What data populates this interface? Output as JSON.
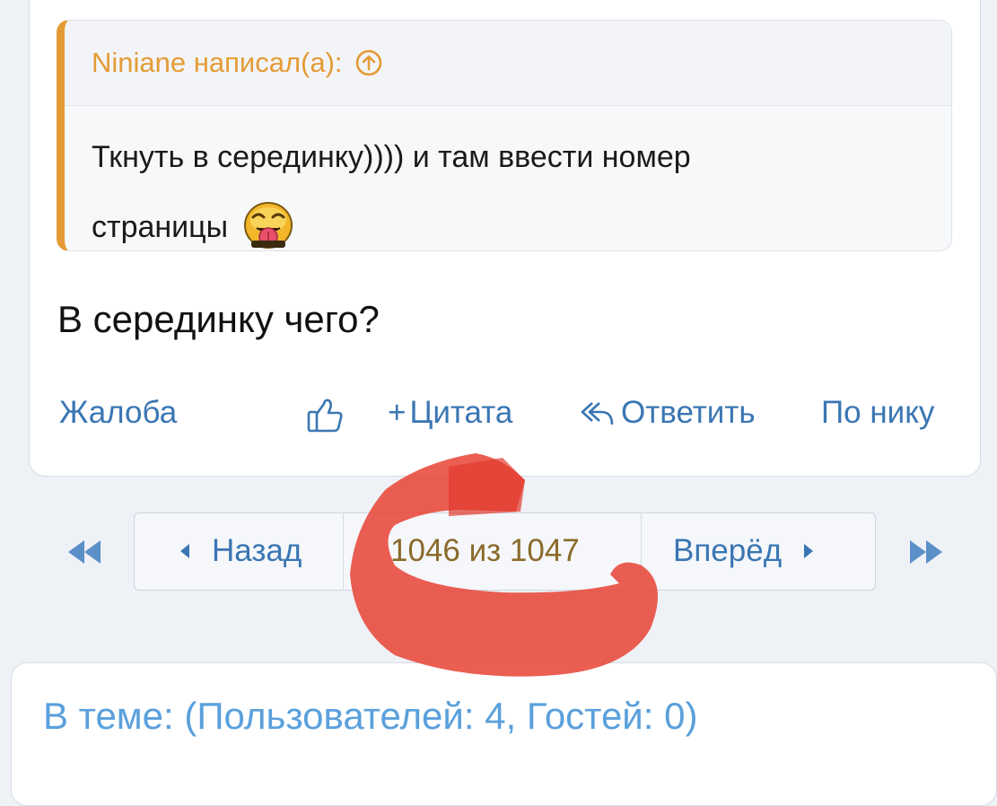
{
  "quote": {
    "author_line": "Niniane написал(а):",
    "text_line1": "Ткнуть в серединку)))) и там ввести номер",
    "text_line2": "страницы"
  },
  "post": {
    "text": "В серединку чего?"
  },
  "actions": {
    "report": "Жалоба",
    "quote": "Цитата",
    "reply": "Ответить",
    "by_nick": "По нику"
  },
  "pager": {
    "prev": "Назад",
    "info": "1046 из 1047",
    "next": "Вперёд"
  },
  "users": {
    "title": "В теме: (Пользователей: 4, Гостей: 0)"
  },
  "colors": {
    "accent": "#3a76b3",
    "quote_accent": "#e49b36",
    "scribble": "#e8483a",
    "users_title": "#5aa0dc"
  }
}
